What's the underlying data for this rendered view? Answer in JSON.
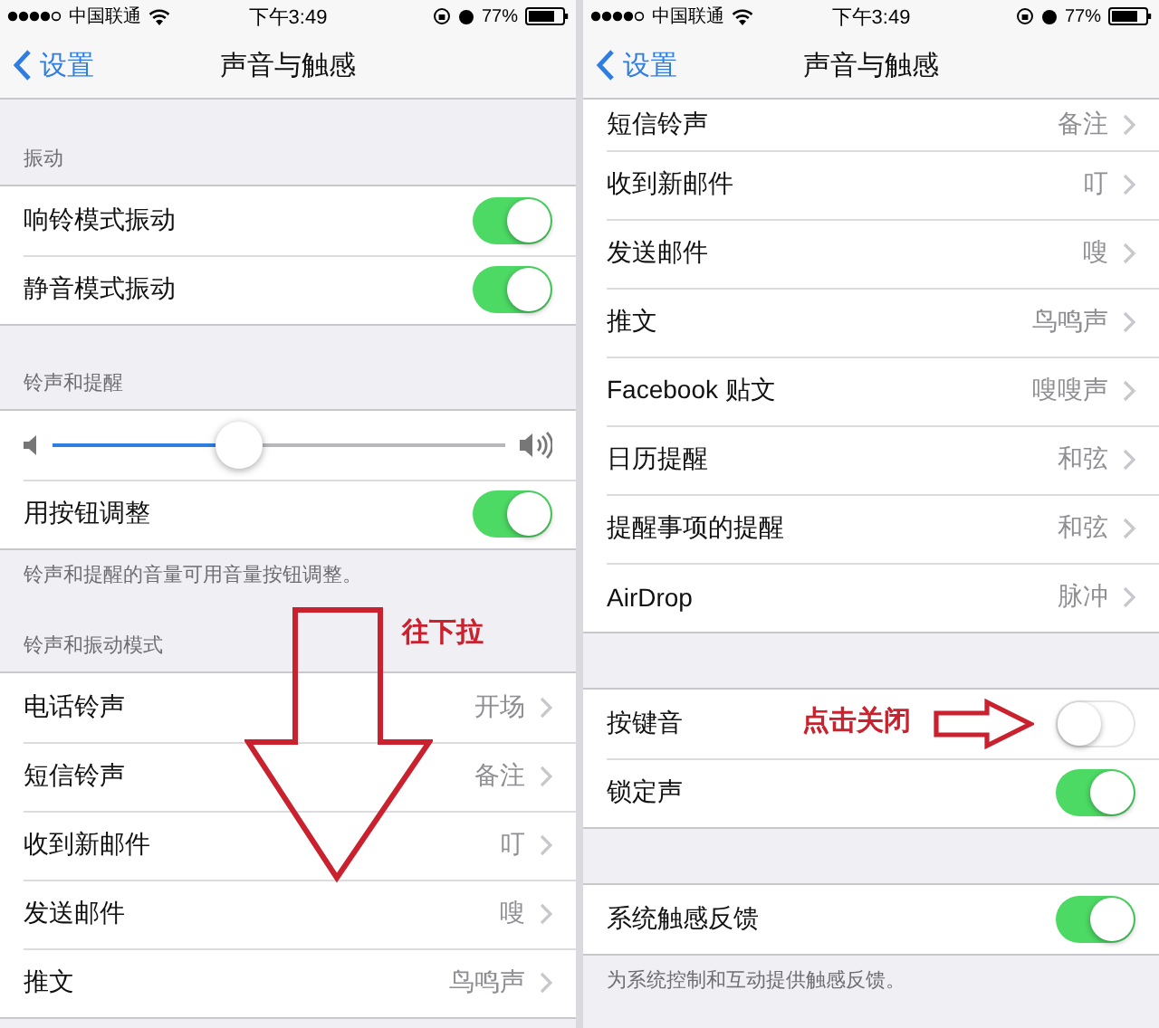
{
  "panels": [
    {
      "status_bar": {
        "carrier": "中国联通",
        "time": "下午3:49",
        "battery": "77%"
      },
      "nav": {
        "back": "设置",
        "title": "声音与触感"
      },
      "sections": [
        {
          "header": "振动",
          "rows": [
            {
              "kind": "toggle",
              "label": "响铃模式振动",
              "on": true
            },
            {
              "kind": "toggle",
              "label": "静音模式振动",
              "on": true
            }
          ]
        },
        {
          "header": "铃声和提醒",
          "footer": "铃声和提醒的音量可用音量按钮调整。",
          "rows": [
            {
              "kind": "slider",
              "level": 0.41
            },
            {
              "kind": "toggle",
              "label": "用按钮调整",
              "on": true
            }
          ]
        },
        {
          "header": "铃声和振动模式",
          "rows": [
            {
              "kind": "detail",
              "label": "电话铃声",
              "value": "开场"
            },
            {
              "kind": "detail",
              "label": "短信铃声",
              "value": "备注"
            },
            {
              "kind": "detail",
              "label": "收到新邮件",
              "value": "叮"
            },
            {
              "kind": "detail",
              "label": "发送邮件",
              "value": "嗖"
            },
            {
              "kind": "detail",
              "label": "推文",
              "value": "鸟鸣声"
            }
          ]
        }
      ],
      "annotation": {
        "kind": "down-arrow",
        "text": "往下拉"
      }
    },
    {
      "status_bar": {
        "carrier": "中国联通",
        "time": "下午3:49",
        "battery": "77%"
      },
      "nav": {
        "back": "设置",
        "title": "声音与触感"
      },
      "sections": [
        {
          "rows": [
            {
              "kind": "detail",
              "label": "短信铃声",
              "value": "备注"
            },
            {
              "kind": "detail",
              "label": "收到新邮件",
              "value": "叮"
            },
            {
              "kind": "detail",
              "label": "发送邮件",
              "value": "嗖"
            },
            {
              "kind": "detail",
              "label": "推文",
              "value": "鸟鸣声"
            },
            {
              "kind": "detail",
              "label": "Facebook 贴文",
              "value": "嗖嗖声"
            },
            {
              "kind": "detail",
              "label": "日历提醒",
              "value": "和弦"
            },
            {
              "kind": "detail",
              "label": "提醒事项的提醒",
              "value": "和弦"
            },
            {
              "kind": "detail",
              "label": "AirDrop",
              "value": "脉冲"
            }
          ]
        },
        {
          "rows": [
            {
              "kind": "toggle",
              "label": "按键音",
              "on": false
            },
            {
              "kind": "toggle",
              "label": "锁定声",
              "on": true
            }
          ]
        },
        {
          "footer": "为系统控制和互动提供触感反馈。",
          "rows": [
            {
              "kind": "toggle",
              "label": "系统触感反馈",
              "on": true
            }
          ]
        }
      ],
      "annotation": {
        "kind": "right-arrow",
        "text": "点击关闭"
      }
    }
  ]
}
